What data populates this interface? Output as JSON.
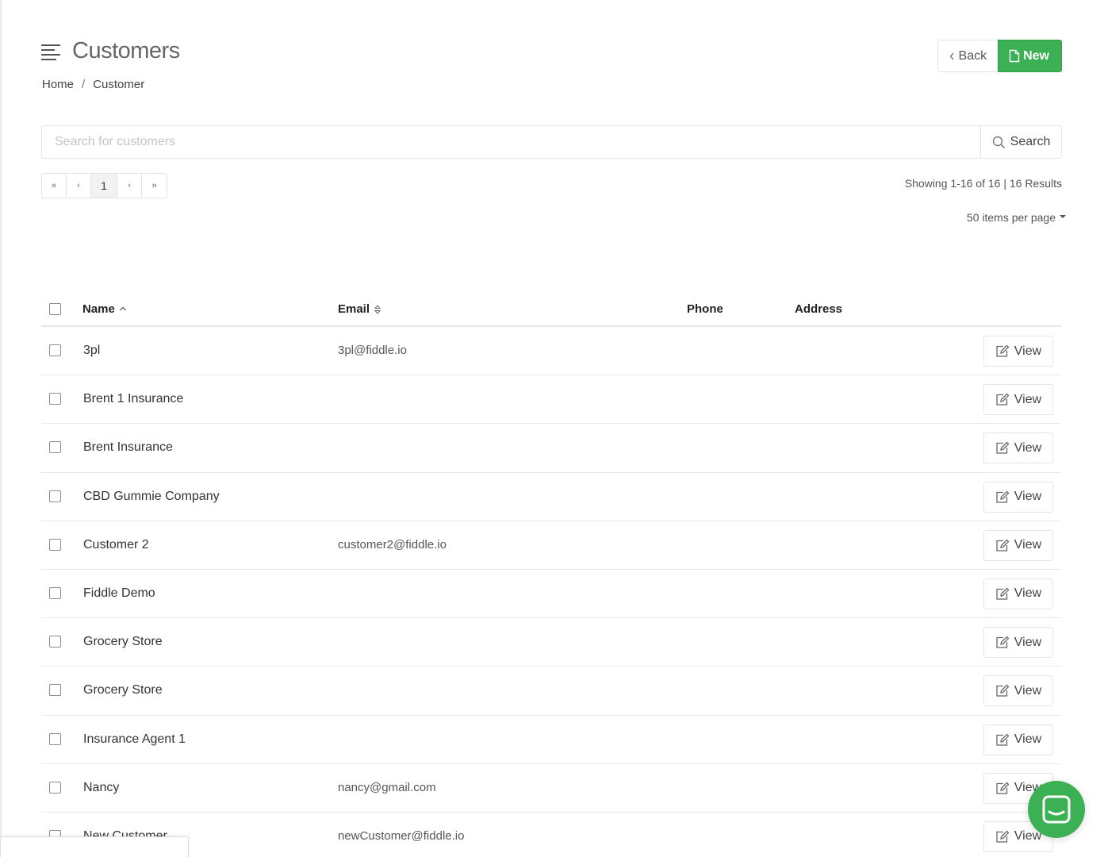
{
  "header": {
    "title": "Customers",
    "menu_icon": "hamburger-menu-icon"
  },
  "breadcrumb": {
    "home": "Home",
    "separator": "/",
    "current": "Customer"
  },
  "toolbar": {
    "back_label": "Back",
    "new_label": "New"
  },
  "search": {
    "placeholder": "Search for customers",
    "value": "",
    "button_label": "Search"
  },
  "pagination": {
    "first": "«",
    "prev": "‹",
    "current_page": "1",
    "next": "›",
    "last": "»",
    "showing_text": "Showing 1-16 of 16 | 16 Results",
    "per_page_label": "50 items per page"
  },
  "table": {
    "columns": {
      "name": "Name",
      "email": "Email",
      "phone": "Phone",
      "address": "Address"
    },
    "view_label": "View",
    "rows": [
      {
        "name": "3pl",
        "email": "3pl@fiddle.io",
        "phone": "",
        "address": ""
      },
      {
        "name": "Brent 1 Insurance",
        "email": "",
        "phone": "",
        "address": ""
      },
      {
        "name": "Brent Insurance",
        "email": "",
        "phone": "",
        "address": ""
      },
      {
        "name": "CBD Gummie Company",
        "email": "",
        "phone": "",
        "address": ""
      },
      {
        "name": "Customer 2",
        "email": "customer2@fiddle.io",
        "phone": "",
        "address": ""
      },
      {
        "name": "Fiddle Demo",
        "email": "",
        "phone": "",
        "address": ""
      },
      {
        "name": "Grocery Store",
        "email": "",
        "phone": "",
        "address": ""
      },
      {
        "name": "Grocery Store",
        "email": "",
        "phone": "",
        "address": ""
      },
      {
        "name": "Insurance Agent 1",
        "email": "",
        "phone": "",
        "address": ""
      },
      {
        "name": "Nancy",
        "email": "nancy@gmail.com",
        "phone": "",
        "address": ""
      },
      {
        "name": "New Customer",
        "email": "newCustomer@fiddle.io",
        "phone": "",
        "address": ""
      }
    ]
  },
  "colors": {
    "accent": "#3cb054",
    "border": "#e6e6e6"
  }
}
